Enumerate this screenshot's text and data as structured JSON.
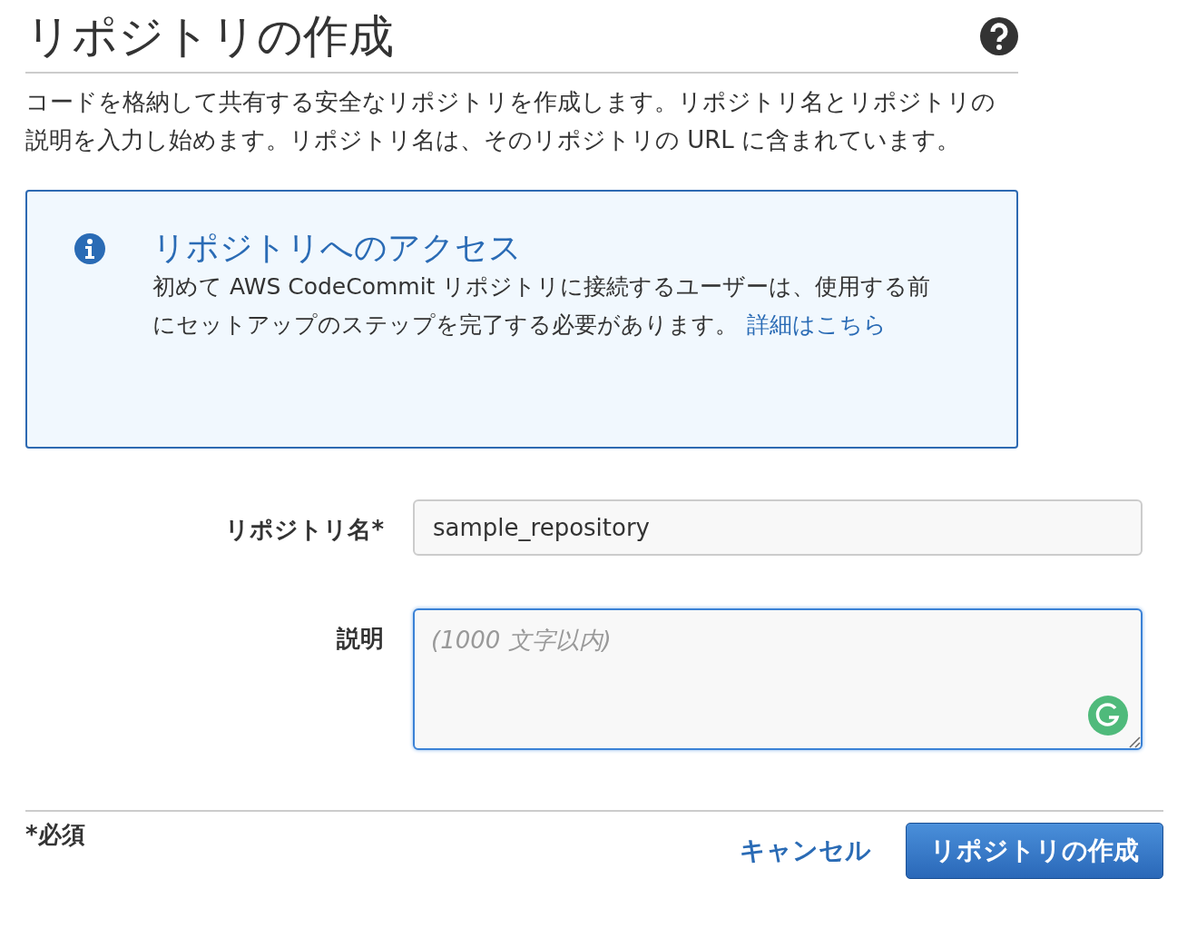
{
  "header": {
    "title": "リポジトリの作成"
  },
  "intro": "コードを格納して共有する安全なリポジトリを作成します。リポジトリ名とリポジトリの説明を入力し始めます。リポジトリ名は、そのリポジトリの URL に含まれています。",
  "info_box": {
    "heading": "リポジトリへのアクセス",
    "body": "初めて AWS CodeCommit リポジトリに接続するユーザーは、使用する前にセットアップのステップを完了する必要があります。",
    "link": "詳細はこちら"
  },
  "form": {
    "fields": [
      {
        "kind": "input",
        "label": "リポジトリ名*",
        "value": "sample_repository",
        "focused": false
      },
      {
        "kind": "textarea",
        "label": "説明",
        "placeholder": "(1000 文字以内)",
        "focused": true
      }
    ]
  },
  "footer": {
    "required_note": "*必須",
    "cancel": "キャンセル",
    "submit": "リポジトリの作成"
  }
}
